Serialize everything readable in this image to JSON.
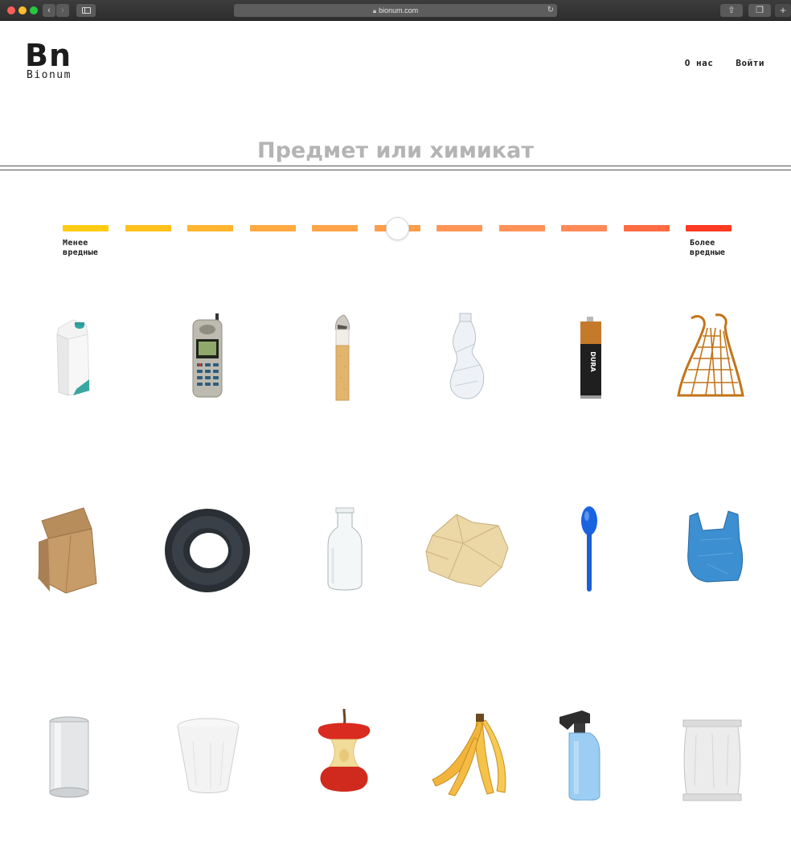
{
  "browser": {
    "url": "bionum.com",
    "back_icon": "chevron-left-icon",
    "forward_icon": "chevron-right-icon",
    "sidebar_icon": "sidebar-icon",
    "share_icon": "share-icon",
    "tabs_icon": "tabs-icon",
    "new_tab_icon": "plus-icon"
  },
  "header": {
    "logo_mark": "Bn",
    "logo_word": "Bionum",
    "nav": [
      "О нас",
      "Войти"
    ]
  },
  "search": {
    "placeholder": "Предмет или химикат",
    "value": ""
  },
  "harm_scale": {
    "label_less": "Менее вредные",
    "label_more": "Более вредные",
    "segment_colors": [
      "#ffcb12",
      "#ffc21c",
      "#ffb530",
      "#ffaa40",
      "#ffa448",
      "#ff9d4b",
      "#ff9656",
      "#ff9257",
      "#ff8a58",
      "#ff6c42",
      "#ff3b23"
    ],
    "selected_segment": 6,
    "segment_count": 11
  },
  "items": [
    {
      "name": "milk-carton",
      "icon": "milk-carton-icon"
    },
    {
      "name": "mobile-phone",
      "icon": "mobile-phone-icon"
    },
    {
      "name": "cigarette-butt",
      "icon": "cigarette-icon"
    },
    {
      "name": "plastic-bottle",
      "icon": "plastic-bottle-icon"
    },
    {
      "name": "battery",
      "icon": "battery-icon"
    },
    {
      "name": "string-bag",
      "icon": "string-bag-icon"
    },
    {
      "name": "paper-bag",
      "icon": "paper-bag-icon"
    },
    {
      "name": "tire",
      "icon": "tire-icon"
    },
    {
      "name": "glass-bottle",
      "icon": "glass-bottle-icon"
    },
    {
      "name": "crumpled-paper",
      "icon": "crumpled-paper-icon"
    },
    {
      "name": "plastic-spoon",
      "icon": "plastic-spoon-icon"
    },
    {
      "name": "plastic-bag",
      "icon": "plastic-bag-icon"
    },
    {
      "name": "aluminum-can",
      "icon": "aluminum-can-icon"
    },
    {
      "name": "plastic-cup",
      "icon": "plastic-cup-icon"
    },
    {
      "name": "apple-core",
      "icon": "apple-core-icon"
    },
    {
      "name": "banana-peel",
      "icon": "banana-peel-icon"
    },
    {
      "name": "spray-bottle",
      "icon": "spray-bottle-icon"
    },
    {
      "name": "snack-package",
      "icon": "snack-package-icon"
    }
  ]
}
